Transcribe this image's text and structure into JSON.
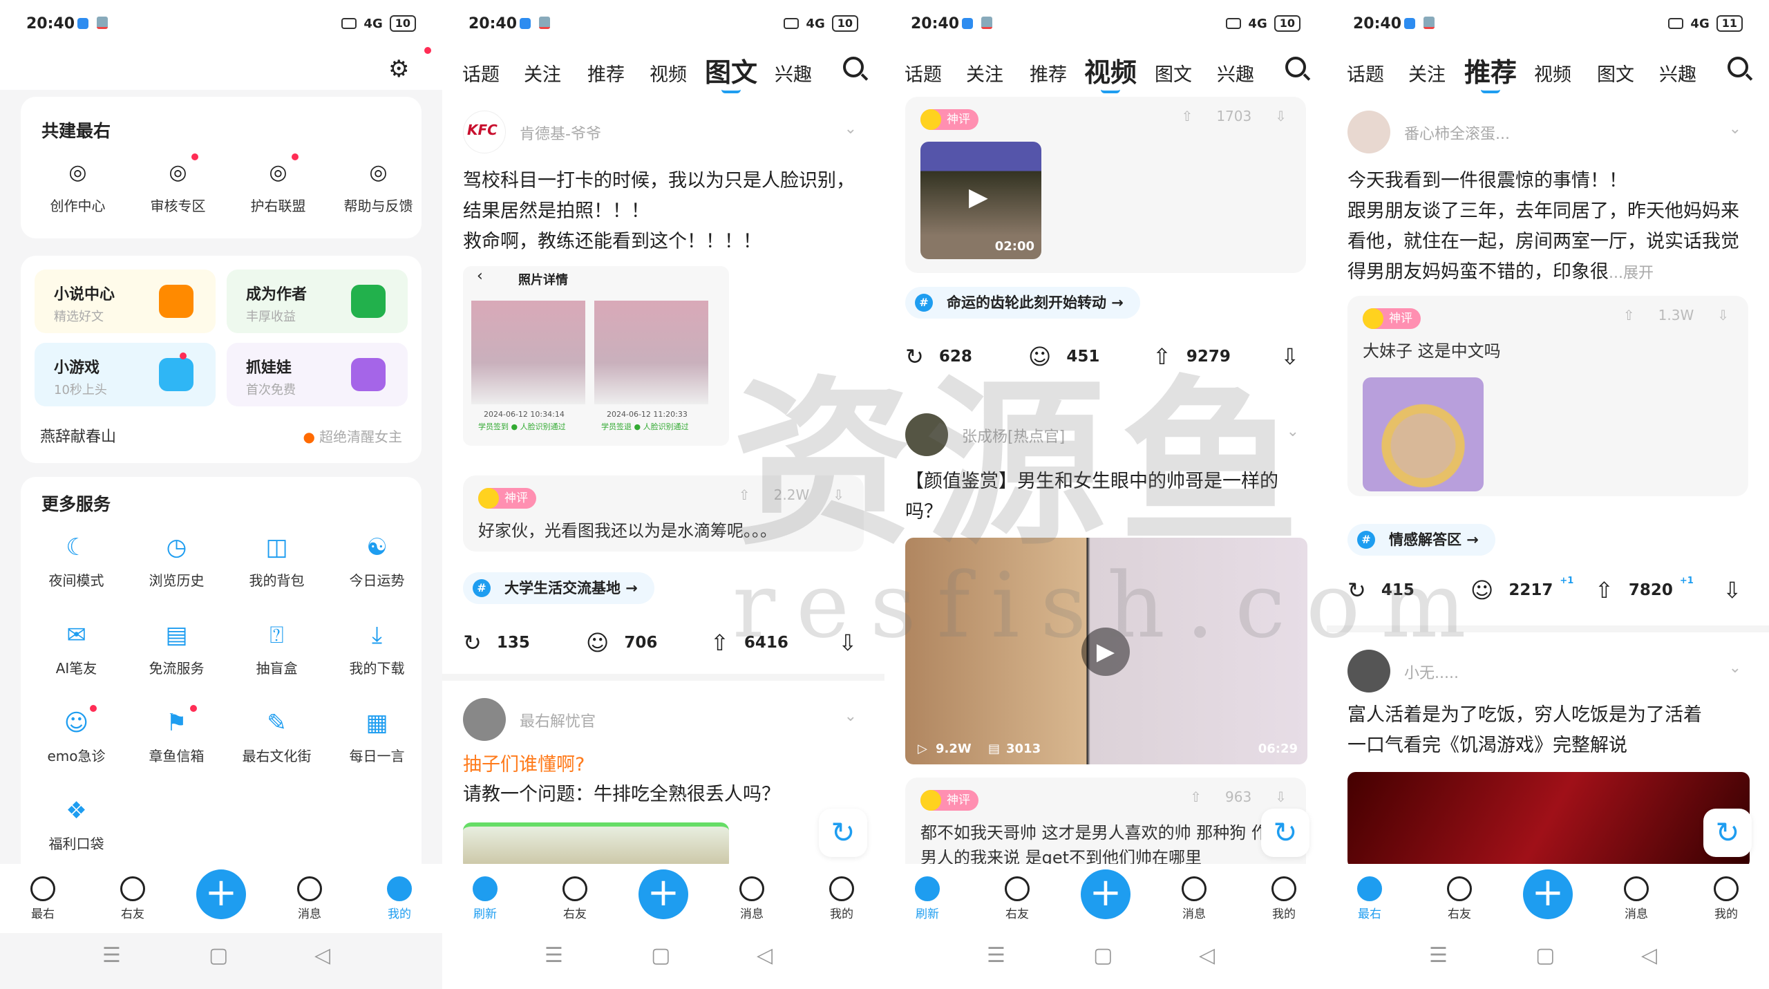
{
  "status_bar": {
    "time": "20:40",
    "signal": "4G",
    "battery": [
      "10",
      "10",
      "10",
      "11"
    ]
  },
  "colors": {
    "accent": "#1e9df0",
    "notify_dot": "#ff2d55",
    "topic_orange": "#ff7a1a"
  },
  "watermark": {
    "text": "资源鱼",
    "sub": "resfish.com"
  },
  "bottom_nav": {
    "profile": [
      "最右",
      "右友",
      "",
      "消息",
      "我的"
    ],
    "refresh": [
      "刷新",
      "右友",
      "",
      "消息",
      "我的"
    ],
    "home": [
      "最右",
      "右友",
      "",
      "消息",
      "我的"
    ]
  },
  "feed_tabs": [
    "话题",
    "关注",
    "推荐",
    "视频",
    "图文",
    "兴趣"
  ],
  "profile": {
    "settings_icon": "gear-icon",
    "build": {
      "title": "共建最右",
      "items": [
        {
          "label": "创作中心",
          "icon": "bulb-icon",
          "dot": false
        },
        {
          "label": "审核专区",
          "icon": "review-icon",
          "dot": true
        },
        {
          "label": "护右联盟",
          "icon": "shield-heart-icon",
          "dot": true
        },
        {
          "label": "帮助与反馈",
          "icon": "help-icon",
          "dot": false
        }
      ]
    },
    "tiles": [
      {
        "title": "小说中心",
        "sub": "精选好文",
        "icon": "book-icon",
        "bg": "#fffbea",
        "color": "#ff8a00"
      },
      {
        "title": "成为作者",
        "sub": "丰厚收益",
        "icon": "pen-icon",
        "bg": "#eef9ee",
        "color": "#22b14c"
      },
      {
        "title": "小游戏",
        "sub": "10秒上头",
        "icon": "gamepad-icon",
        "bg": "#e9f7fe",
        "color": "#2fb6f5"
      },
      {
        "title": "抓娃娃",
        "sub": "首次免费",
        "icon": "bear-icon",
        "bg": "#f7f3fc",
        "color": "#a565e8"
      }
    ],
    "novel": {
      "name": "燕辞献春山",
      "tag": "超绝清醒女主"
    },
    "services": {
      "title": "更多服务",
      "items": [
        {
          "label": "夜间模式",
          "icon": "moon-icon",
          "glyph": "☾",
          "dot": false
        },
        {
          "label": "浏览历史",
          "icon": "clock-icon",
          "glyph": "◷",
          "dot": false
        },
        {
          "label": "我的背包",
          "icon": "backpack-icon",
          "glyph": "◫",
          "dot": false
        },
        {
          "label": "今日运势",
          "icon": "yin-yang-icon",
          "glyph": "☯",
          "dot": false
        },
        {
          "label": "AI笔友",
          "icon": "mail-icon",
          "glyph": "✉",
          "dot": false
        },
        {
          "label": "免流服务",
          "icon": "data-file-icon",
          "glyph": "▤",
          "dot": false
        },
        {
          "label": "抽盲盒",
          "icon": "mystery-box-icon",
          "glyph": "⍰",
          "dot": false
        },
        {
          "label": "我的下载",
          "icon": "download-icon",
          "glyph": "⤓",
          "dot": false
        },
        {
          "label": "emo急诊",
          "icon": "emo-icon",
          "glyph": "☺",
          "dot": true
        },
        {
          "label": "章鱼信箱",
          "icon": "mailbox-icon",
          "glyph": "⚑",
          "dot": true
        },
        {
          "label": "最右文化街",
          "icon": "culture-icon",
          "glyph": "✎",
          "dot": false
        },
        {
          "label": "每日一言",
          "icon": "calendar-icon",
          "glyph": "▦",
          "dot": false
        },
        {
          "label": "福利口袋",
          "icon": "gift-bag-icon",
          "glyph": "❖",
          "dot": false
        }
      ]
    }
  },
  "feed_image_text": {
    "active_tab": 4,
    "post1": {
      "author": "肯德基-爷爷",
      "text": "驾校科目一打卡的时候，我以为只是人脸识别，结果居然是拍照！！！\n救命啊，教练还能看到这个！！！！",
      "image": {
        "title": "照片详情",
        "photos": [
          {
            "time": "2024-06-12 10:34:14",
            "status": "学员签到 ● 人脸识别通过"
          },
          {
            "time": "2024-06-12 11:20:33",
            "status": "学员签退 ● 人脸识别通过"
          }
        ]
      },
      "god_comment": {
        "badge": "神评",
        "votes": "2.2W",
        "text": "好家伙，光看图我还以为是水滴筹呢。。。"
      },
      "topic": "大学生活交流基地 →",
      "share": "135",
      "comments": "706",
      "likes": "6416"
    },
    "post2": {
      "author": "最右解忧官",
      "question": "抽子们谁懂啊?",
      "text": "请教一个问题：牛排吃全熟很丢人吗？"
    }
  },
  "feed_video": {
    "active_tab": 3,
    "post1": {
      "god_comment": {
        "badge": "神评",
        "votes": "1703",
        "video_duration": "02:00"
      },
      "topic": "命运的齿轮此刻开始转动 →",
      "share": "628",
      "comments": "451",
      "likes": "9279"
    },
    "post2": {
      "author": "张成杨[热点官]",
      "text": "【颜值鉴赏】男生和女生眼中的帅哥是一样的吗？",
      "video": {
        "plays": "9.2W",
        "danmaku": "3013",
        "duration": "06:29"
      },
      "god_comment": {
        "badge": "神评",
        "votes": "963",
        "text": "都不如我天哥帅 这才是男人喜欢的帅 那种狗 作为男人的我来说 是get不到他们帅在哪里"
      }
    }
  },
  "feed_recommend": {
    "active_tab": 2,
    "post1": {
      "author": "番心柿全滚蛋...",
      "text": "今天我看到一件很震惊的事情！！\n跟男朋友谈了三年，去年同居了，昨天他妈妈来看他，就住在一起，房间两室一厅，说实话我觉得男朋友妈妈蛮不错的，印象很",
      "expand": "...展开",
      "god_comment": {
        "badge": "神评",
        "votes": "1.3W",
        "text": "大妹子 这是中文吗"
      },
      "topic": "情感解答区 →",
      "share": "415",
      "comments": "2217",
      "likes": "7820",
      "comments_delta": "+1",
      "likes_delta": "+1"
    },
    "post2": {
      "author": "小无.....",
      "text": "富人活着是为了吃饭，穷人吃饭是为了活着\n一口气看完《饥渴游戏》完整解说"
    }
  }
}
